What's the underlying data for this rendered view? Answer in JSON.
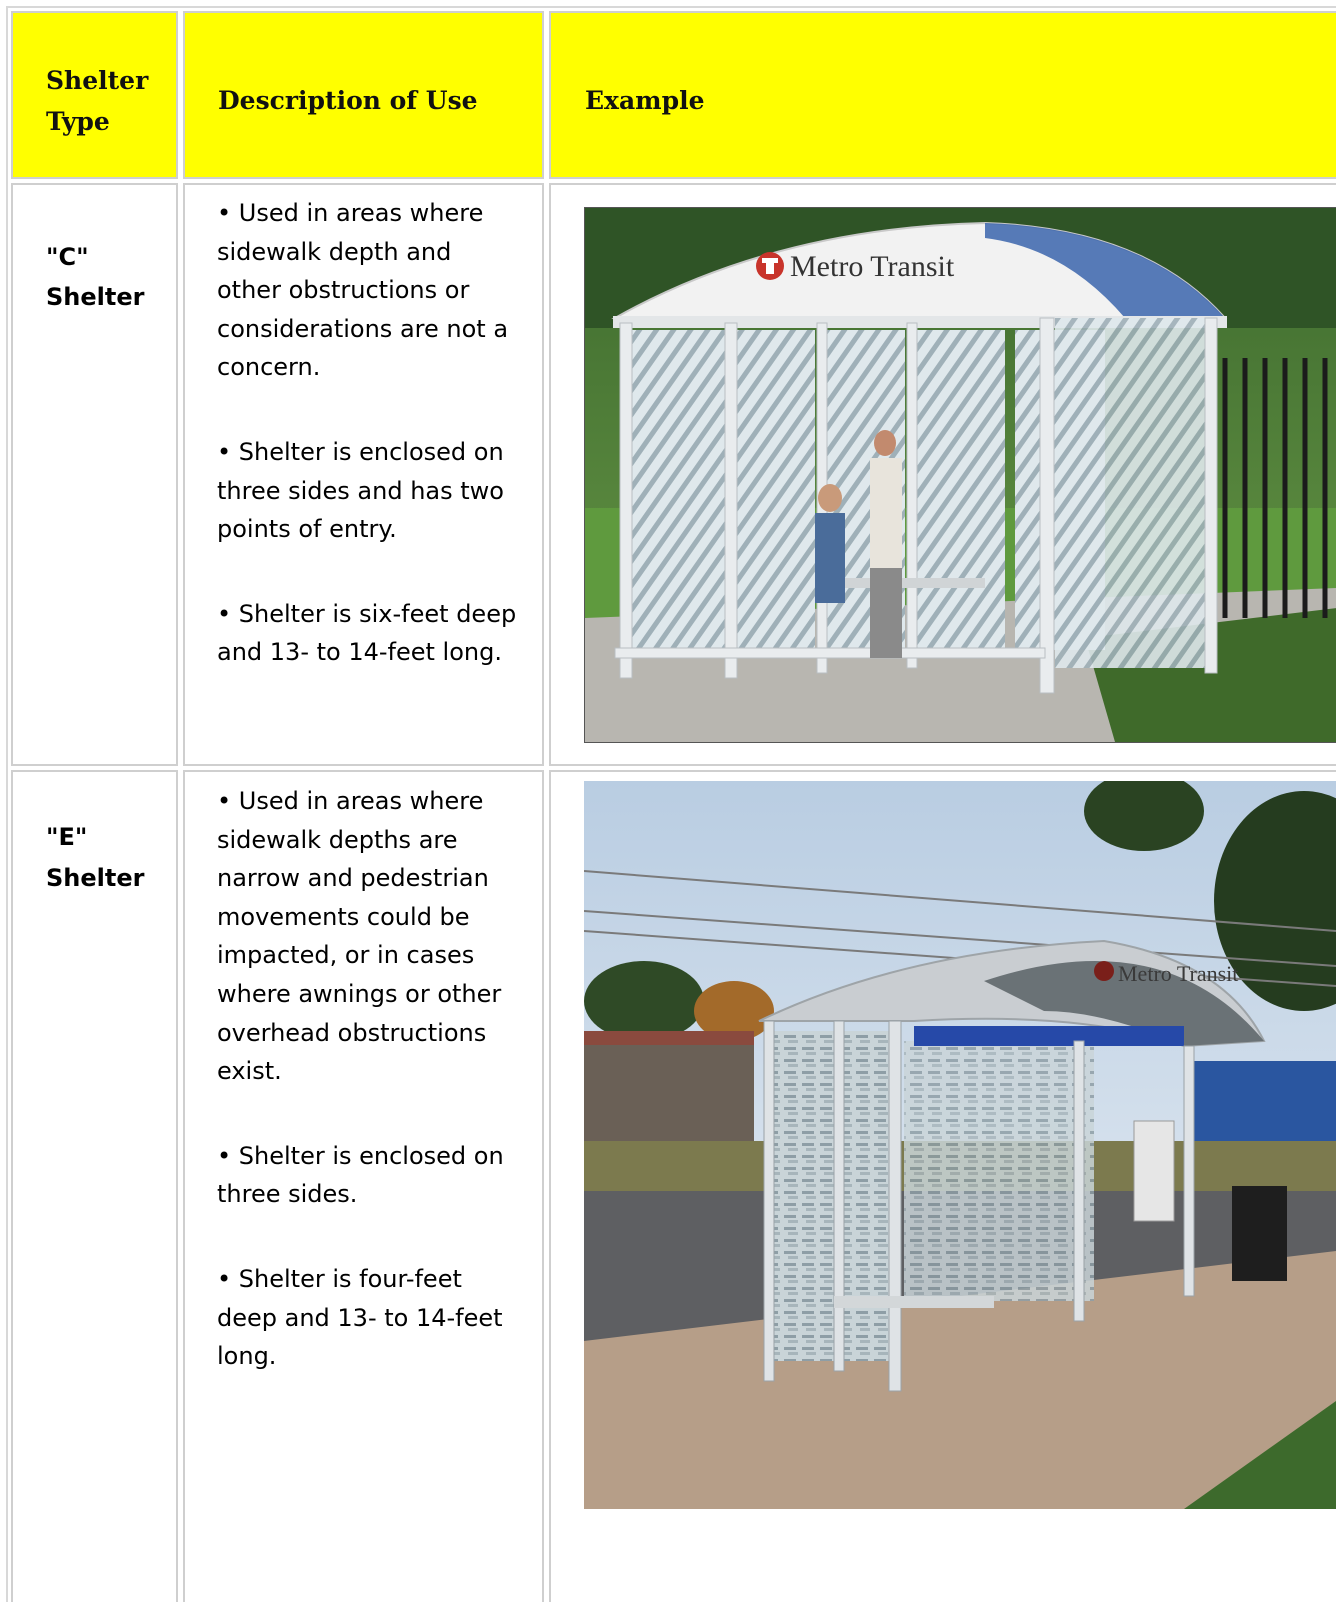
{
  "table": {
    "headers": {
      "type": "Shelter Type",
      "description": "Description of Use",
      "example": "Example"
    },
    "rows": [
      {
        "type_line1": "\"C\"",
        "type_line2": "Shelter",
        "bullets": [
          "• Used in areas where sidewalk depth and other obstructions or considerations are not a concern.",
          "• Shelter is enclosed on three sides and has two points of entry.",
          "• Shelter is six-feet deep and 13- to 14-feet long."
        ],
        "photo_sign": "Metro Transit"
      },
      {
        "type_line1": "\"E\"",
        "type_line2": "Shelter",
        "bullets": [
          "• Used in areas where sidewalk depths are narrow and pedestrian movements could be impacted, or in cases where awnings or other overhead obstructions exist.",
          "• Shelter is enclosed on three sides.",
          "• Shelter is four-feet deep and 13- to 14-feet long."
        ],
        "photo_sign": "Metro Transit"
      }
    ]
  },
  "colors": {
    "header_bg": "#ffff00",
    "border": "#cfcfcf",
    "brand_red": "#c8342b"
  }
}
